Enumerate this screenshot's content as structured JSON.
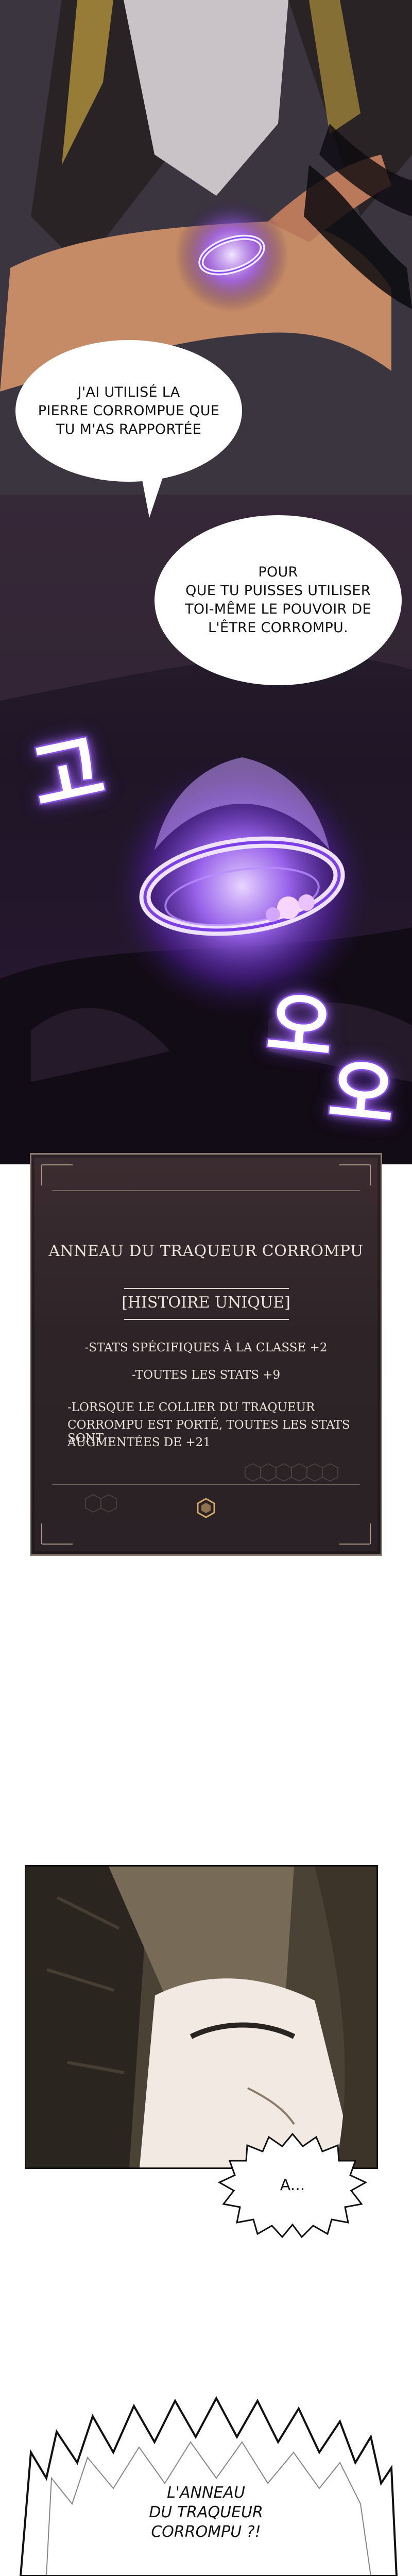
{
  "speech_bubbles": [
    {
      "lines": [
        "J'AI UTILISÉ LA",
        "PIERRE CORROMPUE QUE",
        "TU M'AS RAPPORTÉE"
      ]
    },
    {
      "lines": [
        "POUR",
        "QUE TU PUISSES UTILISER",
        "TOI-MÊME LE POUVOIR DE",
        "L'ÊTRE CORROMPU."
      ]
    }
  ],
  "sound_effects": [
    {
      "text": "고"
    },
    {
      "text": "오"
    },
    {
      "text": "오"
    }
  ],
  "item_window": {
    "title": "ANNEAU DU TRAQUEUR CORROMPU",
    "rarity": "[HISTOIRE UNIQUE]",
    "stats": [
      "-STATS SPÉCIFIQUES À LA CLASSE +2",
      "-TOUTES LES STATS +9"
    ],
    "bonus_lines": [
      "-LORSQUE LE COLLIER DU TRAQUEUR",
      "CORROMPU EST PORTÉ, TOUTES LES STATS SONT",
      "AUGMENTÉES DE +21"
    ]
  },
  "reaction_bubble": {
    "text": "A..."
  },
  "exclaim_bubble": {
    "lines": [
      "L'ANNEAU",
      "DU TRAQUEUR",
      "CORROMPU ?!"
    ]
  },
  "colors": {
    "aura_purple": "#8a4dff",
    "window_border": "#8d7e73",
    "window_bg": "#2e2428"
  }
}
